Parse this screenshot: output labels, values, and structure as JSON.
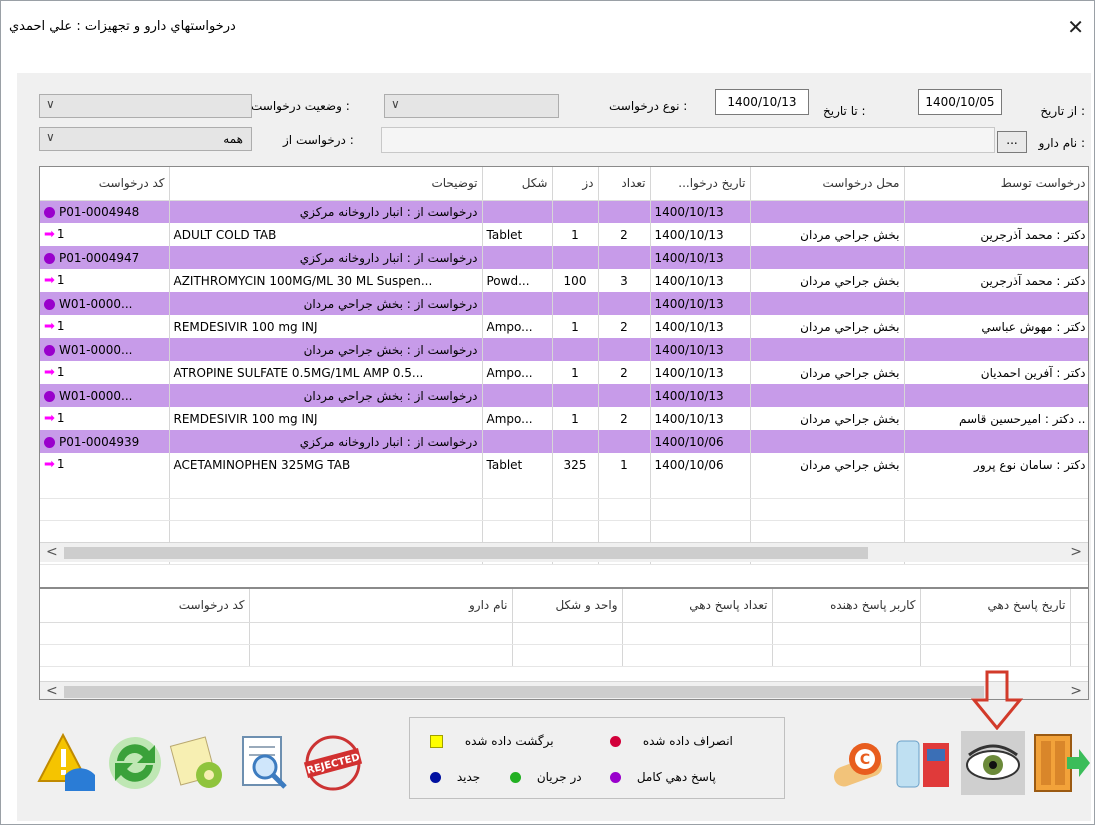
{
  "window": {
    "title": "درخواستهاي دارو و تجهيزات : علي احمدي",
    "close": "✕"
  },
  "filters": {
    "from_date_label": "از تاريخ :",
    "from_date": "1400/10/05",
    "to_date_label": "تا تاريخ :",
    "to_date": "1400/10/13",
    "type_label": "نوع درخواست :",
    "type_value": "",
    "status_label": "وضعيت درخواست :",
    "status_value": "",
    "drug_name_label": "نام دارو :",
    "drug_name_btn": "...",
    "drug_name_value": "",
    "request_from_label": "درخواست از :",
    "request_from_value": "همه"
  },
  "main_grid": {
    "columns": [
      "درخواست توسط",
      "محل درخواست",
      "تاريخ درخوا...",
      "تعداد",
      "دز",
      "شكل",
      "توضيحات",
      "كد درخواست"
    ],
    "rows": [
      {
        "type": "group",
        "code": "P01-0004948",
        "desc": "درخواست از : انبار داروخانه مركزي",
        "date": "1400/10/13"
      },
      {
        "type": "child",
        "code": "1",
        "desc": "ADULT COLD TAB",
        "shape": "Tablet",
        "dose": "1",
        "count": "2",
        "date": "1400/10/13",
        "place": "بخش جراحي مردان",
        "by": "دكتر : محمد آذرجرين"
      },
      {
        "type": "group",
        "code": "P01-0004947",
        "desc": "درخواست از : انبار داروخانه مركزي",
        "date": "1400/10/13"
      },
      {
        "type": "child",
        "code": "1",
        "desc": "AZITHROMYCIN 100MG/ML 30 ML Suspen...",
        "shape": "Powd...",
        "dose": "100",
        "count": "3",
        "date": "1400/10/13",
        "place": "بخش جراحي مردان",
        "by": "دكتر : محمد آذرجرين"
      },
      {
        "type": "group",
        "code": "W01-0000...",
        "desc": "درخواست از : بخش جراحي مردان",
        "date": "1400/10/13"
      },
      {
        "type": "child",
        "code": "1",
        "desc": "REMDESIVIR 100 mg INJ",
        "shape": "Ampo...",
        "dose": "1",
        "count": "2",
        "date": "1400/10/13",
        "place": "بخش جراحي مردان",
        "by": "دكتر : مهوش عباسي"
      },
      {
        "type": "group",
        "code": "W01-0000...",
        "desc": "درخواست از : بخش جراحي مردان",
        "date": "1400/10/13"
      },
      {
        "type": "child",
        "code": "1",
        "desc": "ATROPINE SULFATE 0.5MG/1ML AMP 0.5...",
        "shape": "Ampo...",
        "dose": "1",
        "count": "2",
        "date": "1400/10/13",
        "place": "بخش جراحي مردان",
        "by": "دكتر : آفرين احمديان"
      },
      {
        "type": "group",
        "code": "W01-0000...",
        "desc": "درخواست از : بخش جراحي مردان",
        "date": "1400/10/13"
      },
      {
        "type": "child",
        "code": "1",
        "desc": "REMDESIVIR 100 mg INJ",
        "shape": "Ampo...",
        "dose": "1",
        "count": "2",
        "date": "1400/10/13",
        "place": "بخش جراحي مردان",
        "by": ".. دكتر : اميرحسين قاسم"
      },
      {
        "type": "group",
        "code": "P01-0004939",
        "desc": "درخواست از : انبار داروخانه مركزي",
        "date": "1400/10/06"
      },
      {
        "type": "child",
        "code": "1",
        "desc": "ACETAMINOPHEN 325MG TAB",
        "shape": "Tablet",
        "dose": "325",
        "count": "1",
        "date": "1400/10/06",
        "place": "بخش جراحي مردان",
        "by": "دكتر : سامان نوع پرور"
      }
    ]
  },
  "detail_grid": {
    "columns": [
      "تاريخ پاسخ دهي",
      "كاربر پاسخ دهنده",
      "تعداد پاسخ دهي",
      "واحد و شكل",
      "نام دارو",
      "كد درخواست"
    ]
  },
  "legend": {
    "returned": "برگشت داده شده",
    "cancelled": "انصراف داده شده",
    "new": "جديد",
    "in_progress": "در جريان",
    "complete": "پاسخ دهي كامل"
  },
  "toolbar_left": {
    "rejected_text": "REJECTED"
  },
  "colors": {
    "group_row": "#c79be9",
    "returned": "#ffff00",
    "cancelled": "#d2003a",
    "new": "#0010a0",
    "in_progress": "#22b022",
    "complete": "#9900cc"
  }
}
